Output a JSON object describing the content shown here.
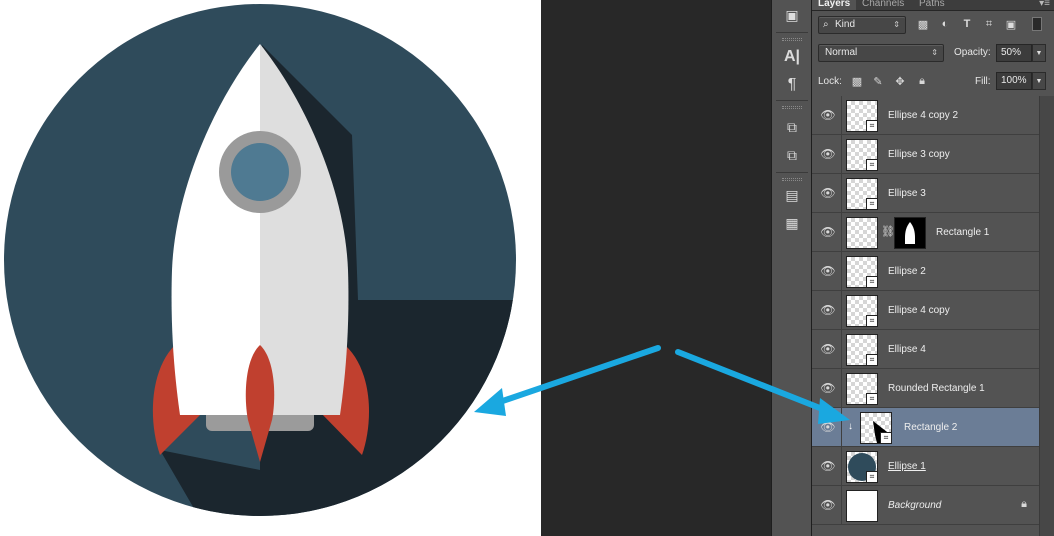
{
  "panel": {
    "tabs": [
      "Layers",
      "Channels",
      "Paths"
    ],
    "menu_icon": "panel-menu-icon",
    "filter": {
      "kind_label": "Kind"
    },
    "blend_mode": "Normal",
    "opacity_label": "Opacity:",
    "opacity_value": "50%",
    "lock_label": "Lock:",
    "fill_label": "Fill:",
    "fill_value": "100%"
  },
  "layers": [
    {
      "name": "Ellipse 4 copy 2",
      "thumb": "transparent",
      "has_shape_badge": true
    },
    {
      "name": "Ellipse 3 copy",
      "thumb": "transparent",
      "has_shape_badge": true
    },
    {
      "name": "Ellipse 3",
      "thumb": "transparent",
      "has_shape_badge": true
    },
    {
      "name": "Rectangle 1",
      "thumb": "transparent",
      "has_mask": true
    },
    {
      "name": "Ellipse 2",
      "thumb": "transparent",
      "has_shape_badge": true
    },
    {
      "name": "Ellipse 4 copy",
      "thumb": "transparent",
      "has_shape_badge": true
    },
    {
      "name": "Ellipse 4",
      "thumb": "transparent",
      "has_shape_badge": true
    },
    {
      "name": "Rounded Rectangle 1",
      "thumb": "transparent",
      "has_shape_badge": true
    },
    {
      "name": "Rectangle 2",
      "thumb": "transparent",
      "has_shape_badge": true,
      "selected": true,
      "clipped": true
    },
    {
      "name": "Ellipse 1",
      "thumb": "transparent",
      "has_shape_badge": true,
      "underline": true
    },
    {
      "name": "Background",
      "thumb": "white",
      "italic": true,
      "locked": true
    }
  ],
  "colors": {
    "circle_bg": "#2f4b5b",
    "long_shadow": "#1b262e",
    "rocket_left": "#ffffff",
    "rocket_right": "#dedede",
    "window_ring": "#9a9a9a",
    "window_glass": "#4f7a92",
    "fins": "#c0402f",
    "nozzle": "#9b9b9b",
    "annotation_arrow": "#1aa8e0",
    "selected_row": "#6b7d96"
  }
}
